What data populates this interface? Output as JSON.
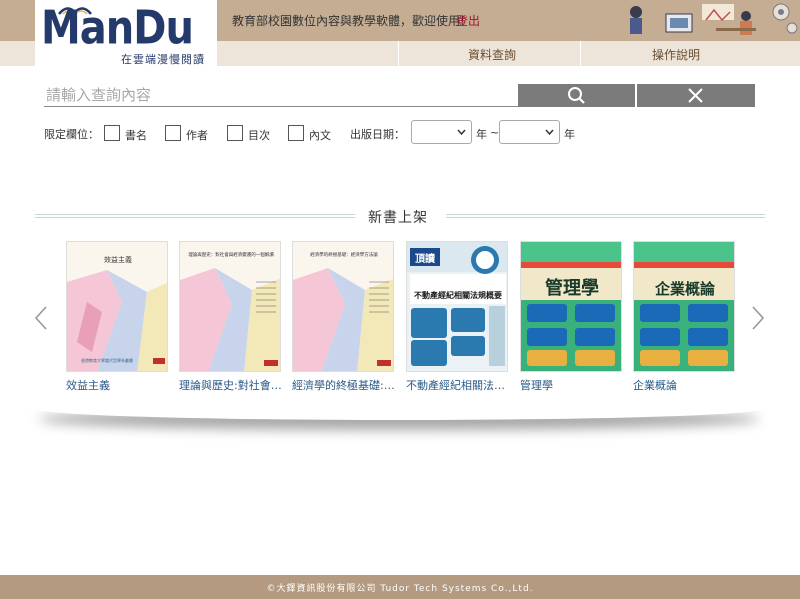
{
  "header": {
    "logo_text": "ManDu",
    "logo_subtitle": "在雲端漫慢閱讀",
    "welcome": "教育部校園數位內容與教學軟體，歡迎使用!",
    "logout": "登出",
    "nav": [
      {
        "label": "資料查詢"
      },
      {
        "label": "操作說明"
      }
    ]
  },
  "search": {
    "placeholder": "請輸入查詢內容",
    "value": ""
  },
  "filters": {
    "label": "限定欄位：",
    "fields": [
      {
        "label": "書名",
        "checked": false
      },
      {
        "label": "作者",
        "checked": false
      },
      {
        "label": "目次",
        "checked": false
      },
      {
        "label": "內文",
        "checked": false
      }
    ],
    "date_label": "出版日期：",
    "year_unit": "年",
    "range_sep": "~"
  },
  "new_books": {
    "title": "新書上架",
    "books": [
      {
        "title": "效益主義",
        "cover_title": "效益主義",
        "cover_text": "香港教育大學當代哲學系叢書"
      },
      {
        "title": "理論與歷史:對社會與經濟變遷的詮釋",
        "cover_title": "理論與歷史：對社會與經濟變遷的一個解讀",
        "cover_text": ""
      },
      {
        "title": "經濟學的終極基礎:經濟學方法論",
        "cover_title": "經濟學的終極基礎：經濟學方法論",
        "cover_text": ""
      },
      {
        "title": "不動產經紀相關法規概要",
        "cover_title": "不動產經紀相關法規概要",
        "cover_text": "頂讀"
      },
      {
        "title": "管理學",
        "cover_title": "管理學",
        "cover_text": ""
      },
      {
        "title": "企業概論",
        "cover_title": "企業概論",
        "cover_text": ""
      }
    ]
  },
  "footer": {
    "text": "©大鐸資訊股份有限公司 Tudor Tech Systems Co.,Ltd."
  },
  "colors": {
    "header_top": "#c4ad93",
    "header_nav": "#ede5d9",
    "logo": "#243a6b",
    "logout": "#a0162d",
    "button_gray": "#7b7b7b",
    "footer": "#b39a80",
    "book_link": "#2a5a8a"
  }
}
